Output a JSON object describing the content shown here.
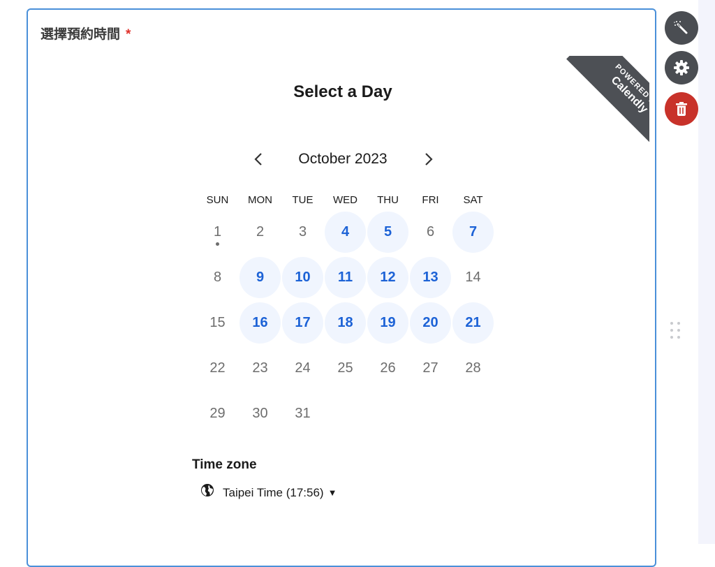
{
  "field": {
    "label": "選擇預約時間",
    "required_mark": "*"
  },
  "ribbon": {
    "line1": "POWERED BY",
    "line2": "Calendly"
  },
  "calendar": {
    "title": "Select a Day",
    "month": "October 2023",
    "prev_icon": "chevron-left-icon",
    "next_icon": "chevron-right-icon",
    "weekdays": [
      "SUN",
      "MON",
      "TUE",
      "WED",
      "THU",
      "FRI",
      "SAT"
    ],
    "weeks": [
      [
        "1",
        "2",
        "3",
        "4",
        "5",
        "6",
        "7"
      ],
      [
        "8",
        "9",
        "10",
        "11",
        "12",
        "13",
        "14"
      ],
      [
        "15",
        "16",
        "17",
        "18",
        "19",
        "20",
        "21"
      ],
      [
        "22",
        "23",
        "24",
        "25",
        "26",
        "27",
        "28"
      ],
      [
        "29",
        "30",
        "31",
        "",
        "",
        "",
        ""
      ]
    ],
    "available_days": [
      "4",
      "5",
      "7",
      "9",
      "10",
      "11",
      "12",
      "13",
      "16",
      "17",
      "18",
      "19",
      "20",
      "21"
    ],
    "today": "1"
  },
  "timezone": {
    "heading": "Time zone",
    "value": "Taipei Time (17:56)",
    "icon": "globe-icon"
  },
  "tools": [
    {
      "name": "magic-wand",
      "icon": "magic-wand-icon"
    },
    {
      "name": "settings",
      "icon": "gear-icon"
    },
    {
      "name": "delete",
      "icon": "trash-icon"
    }
  ],
  "colors": {
    "accent": "#1c62d6",
    "available_bg": "#f0f5fe",
    "field_border": "#4a90d9",
    "delete": "#c8322a",
    "tool": "#4a4d52"
  }
}
